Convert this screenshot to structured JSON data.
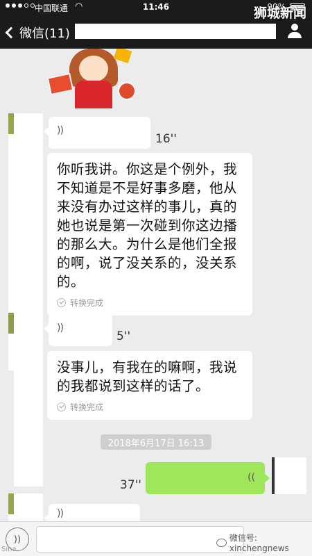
{
  "status_bar": {
    "carrier": "中国联通",
    "wifi": "WiFi",
    "time": "11:46",
    "battery": "90%"
  },
  "watermark_top": "狮城新闻",
  "nav": {
    "back_label": "微信(11)"
  },
  "messages": [
    {
      "type": "voice",
      "duration": "16''"
    },
    {
      "type": "transcript",
      "text": "你听我讲。你这是个例外，我不知道是不是好事多磨，他从来没有办过这样的事儿，真的她也说是第一次碰到你这边播的那么大。为什么是他们全报的啊，说了没关系的，没关系的。",
      "status": "转换完成"
    },
    {
      "type": "voice",
      "duration": "5''"
    },
    {
      "type": "transcript",
      "text": "没事儿，有我在的嘛啊，我说的我都说到这样的话了。",
      "status": "转换完成"
    }
  ],
  "timestamp": "2018年6月17日 16:13",
  "my_voice": {
    "duration": "37''"
  },
  "input": {
    "watermark": "微信号: xinchengnews",
    "left_mark": "Sina"
  }
}
